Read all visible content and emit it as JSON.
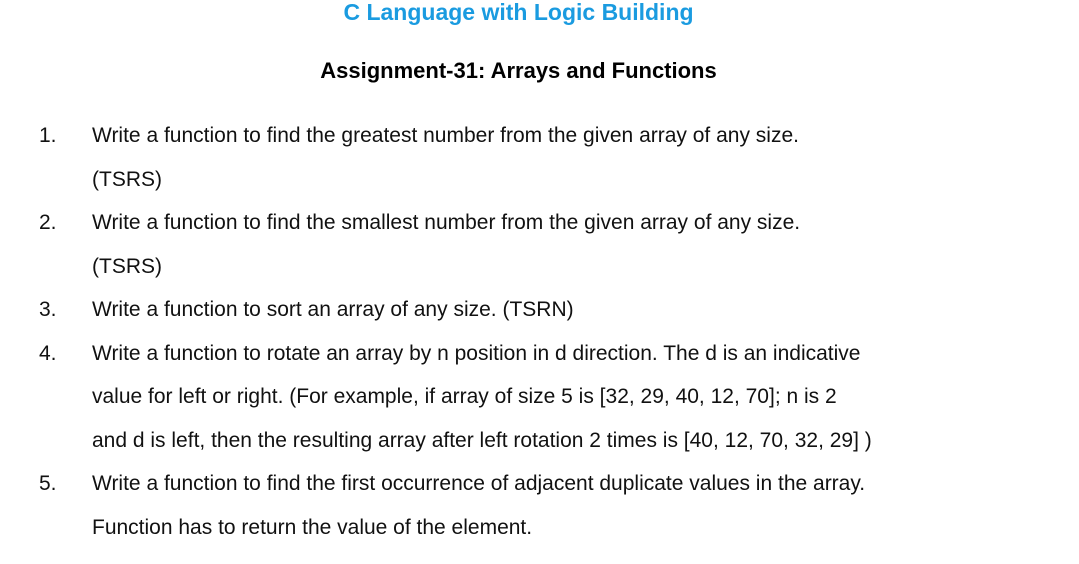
{
  "header": {
    "course_title": "C Language with Logic Building",
    "assignment_title": "Assignment-31: Arrays and Functions"
  },
  "questions": [
    {
      "number": "1.",
      "lines": [
        "Write a function to find the greatest number from the given array of any size.",
        "(TSRS)"
      ]
    },
    {
      "number": "2.",
      "lines": [
        "Write a function to find the smallest number from the given array of any size.",
        "(TSRS)"
      ]
    },
    {
      "number": "3.",
      "lines": [
        "Write a function to sort an array of any size. (TSRN)"
      ]
    },
    {
      "number": "4.",
      "lines": [
        "Write a function to rotate an array by n position in d direction. The d is an indicative",
        "value for left or right. (For example, if array of size 5 is [32, 29, 40, 12, 70];  n is 2",
        "and d is left, then the resulting array after left rotation 2 times is [40, 12, 70, 32, 29] )"
      ]
    },
    {
      "number": "5.",
      "lines": [
        "Write a function to find the first occurrence of adjacent duplicate values in the array.",
        "Function has to return the value of the element."
      ]
    }
  ]
}
